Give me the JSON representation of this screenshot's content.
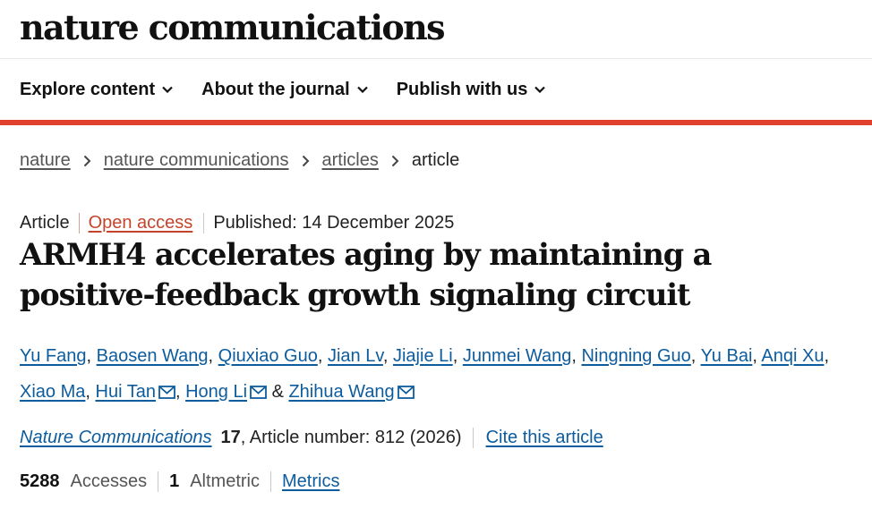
{
  "site": {
    "logo": "nature communications"
  },
  "nav": {
    "items": [
      {
        "label": "Explore content"
      },
      {
        "label": "About the journal"
      },
      {
        "label": "Publish with us"
      }
    ]
  },
  "breadcrumb": [
    "nature",
    "nature communications",
    "articles",
    "article"
  ],
  "article": {
    "type": "Article",
    "access": "Open access",
    "published": "Published: 14 December 2025",
    "title": "ARMH4 accelerates aging by maintaining a positive-feedback growth signaling circuit",
    "authors": [
      "Yu Fang",
      "Baosen Wang",
      "Qiuxiao Guo",
      "Jian Lv",
      "Jiajie Li",
      "Junmei Wang",
      "Ningning Guo",
      "Yu Bai",
      "Anqi Xu",
      "Xiao Ma",
      "Hui Tan",
      "Hong Li",
      "Zhihua Wang"
    ],
    "separators": {
      "comma": ", ",
      "ampersand": " & "
    },
    "citation": {
      "journal": "Nature Communications",
      "volume": "17",
      "article_number": ", Article number: 812 (2026)",
      "cite_link": "Cite this article"
    },
    "metrics": {
      "accesses_count": "5288",
      "accesses_label": "Accesses",
      "altmetric_count": "1",
      "altmetric_label": "Altmetric",
      "metrics_link": "Metrics"
    }
  },
  "colors": {
    "accent_red": "#e0412e",
    "link_blue": "#0d5c9e",
    "open_access": "#c4452b"
  }
}
